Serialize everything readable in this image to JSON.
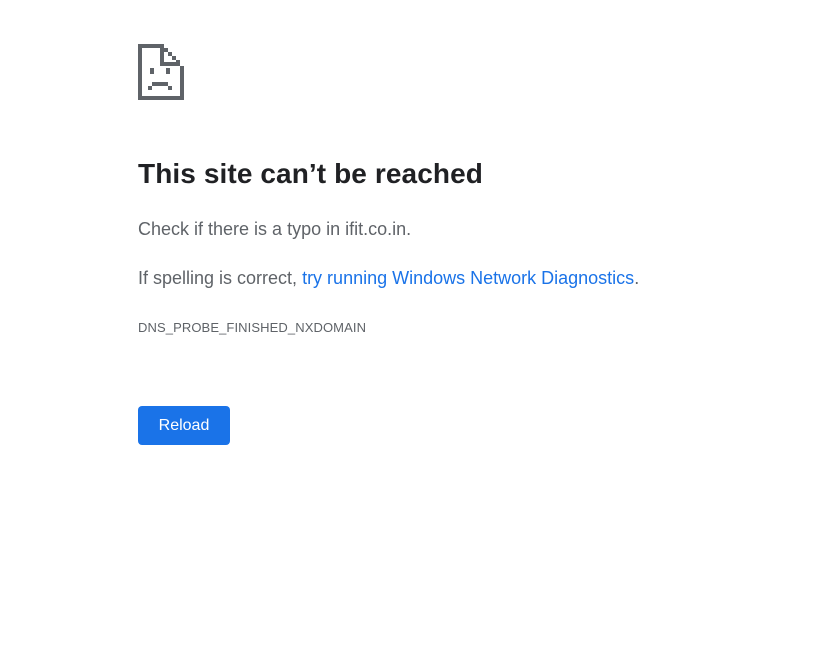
{
  "error": {
    "title": "This site can’t be reached",
    "message_prefix": "Check if there is a typo in ",
    "domain": "ifit.co.in",
    "message_suffix": ".",
    "suggestion_prefix": "If spelling is correct, ",
    "suggestion_link": "try running Windows Network Diagnostics",
    "suggestion_suffix": ".",
    "code": "DNS_PROBE_FINISHED_NXDOMAIN",
    "icon": "sad-page-icon"
  },
  "actions": {
    "reload_label": "Reload"
  },
  "colors": {
    "accent": "#1a73e8",
    "title_text": "#202124",
    "body_text": "#5f6368",
    "icon": "#5f6368",
    "background": "#ffffff"
  }
}
